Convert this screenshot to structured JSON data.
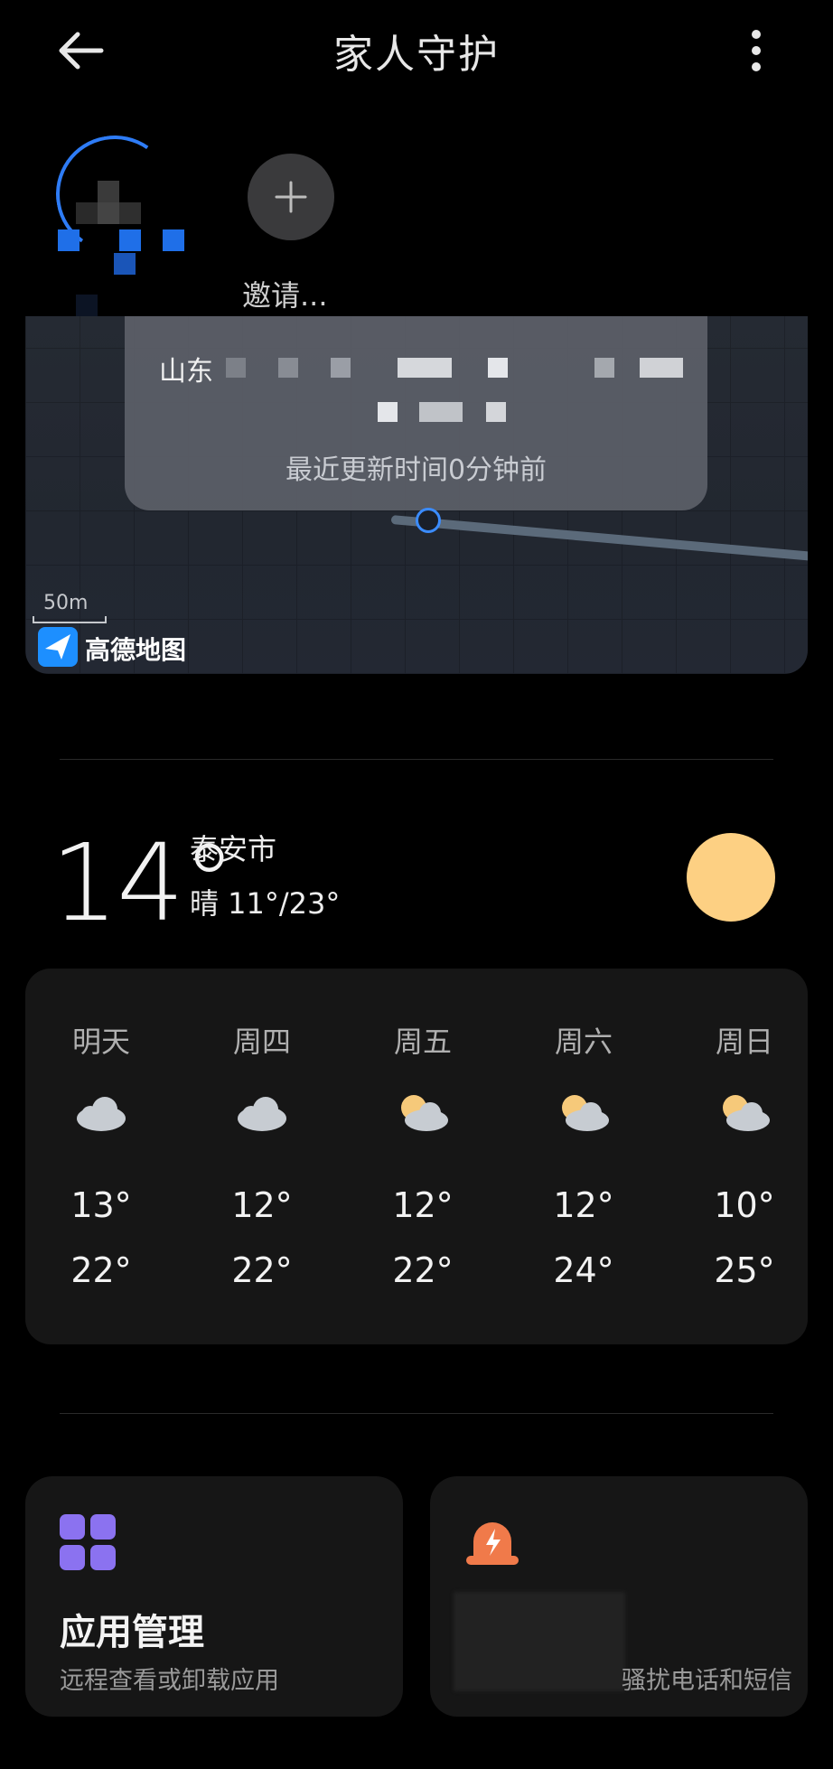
{
  "header": {
    "title": "家人守护"
  },
  "member": {
    "invite_label": "邀请..."
  },
  "location": {
    "address_prefix": "山东",
    "update_text": "最近更新时间0分钟前",
    "scale_label": "50m",
    "map_provider": "高德地图"
  },
  "weather": {
    "current_temp": "14°",
    "city": "泰安市",
    "condition_range": "晴 11°/23°",
    "forecast": [
      {
        "day": "明天",
        "icon": "cloudy-icon",
        "low": "13°",
        "high": "22°"
      },
      {
        "day": "周四",
        "icon": "cloudy-icon",
        "low": "12°",
        "high": "22°"
      },
      {
        "day": "周五",
        "icon": "partly-cloudy-icon",
        "low": "12°",
        "high": "22°"
      },
      {
        "day": "周六",
        "icon": "partly-cloudy-icon",
        "low": "12°",
        "high": "24°"
      },
      {
        "day": "周日",
        "icon": "partly-cloudy-icon",
        "low": "10°",
        "high": "25°"
      }
    ]
  },
  "tiles": {
    "app_manage": {
      "title": "应用管理",
      "subtitle": "远程查看或卸载应用",
      "icon": "apps-grid-icon"
    },
    "harassment": {
      "subtitle": "骚扰电话和短信",
      "icon": "alarm-icon"
    }
  },
  "colors": {
    "accent_blue": "#2e7cf6",
    "sun": "#fdd083",
    "purple": "#8b72f0",
    "orange": "#f07a4a"
  }
}
